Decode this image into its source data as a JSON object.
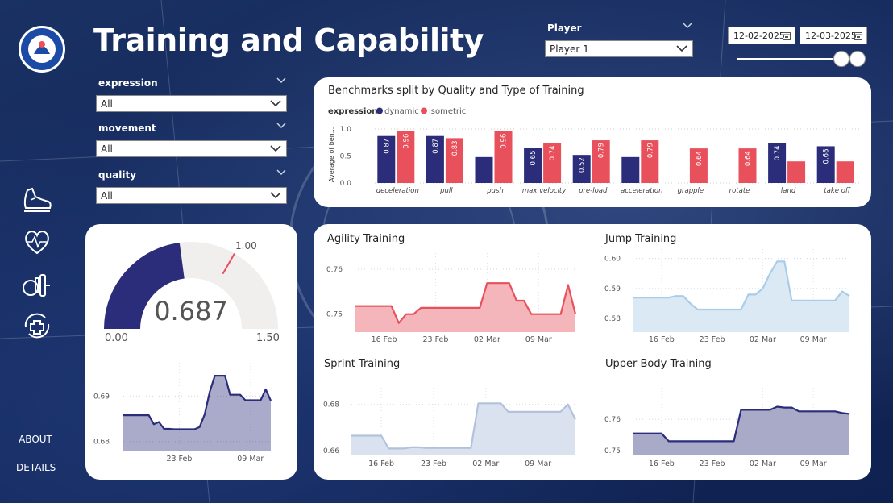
{
  "header": {
    "title": "Training and Capability"
  },
  "filters": {
    "expression": {
      "label": "expression",
      "value": "All"
    },
    "movement": {
      "label": "movement",
      "value": "All"
    },
    "quality": {
      "label": "quality",
      "value": "All"
    }
  },
  "player": {
    "label": "Player",
    "value": "Player 1"
  },
  "date_range": {
    "start": "12-02-2025",
    "end": "12-03-2025",
    "slider_start_pct": 88,
    "slider_end_pct": 100
  },
  "nav": {
    "about": "ABOUT",
    "details": "DETAILS"
  },
  "sidebar_icons": [
    "running-shoe-icon",
    "heart-icon",
    "dumbbell-icon",
    "medical-plus-icon"
  ],
  "colors": {
    "navy": "#2b2d7a",
    "red": "#e8505b",
    "light_blue": "#a9cde9",
    "grey_blue": "#b9c7dd",
    "gauge_bg": "#f0efee",
    "background": "#13275a"
  },
  "chart_data": [
    {
      "type": "bar",
      "title": "Benchmarks split by Quality and Type of Training",
      "legend_title": "expression",
      "legend_position": "top-left",
      "ylabel": "Average of ben...",
      "ylim": [
        0,
        1.0
      ],
      "yticks": [
        "0.0",
        "0.5",
        "1.0"
      ],
      "categories": [
        "deceleration",
        "pull",
        "push",
        "max velocity",
        "pre-load",
        "acceleration",
        "grapple",
        "rotate",
        "land",
        "take off"
      ],
      "series": [
        {
          "name": "dynamic",
          "color": "#2b2d7a",
          "values": [
            0.87,
            0.87,
            0.48,
            0.65,
            0.52,
            0.48,
            null,
            null,
            0.74,
            0.68
          ],
          "labels": [
            "0.87",
            "0.87",
            "",
            "0.65",
            "0.52",
            "",
            "",
            "",
            "0.74",
            "0.68"
          ]
        },
        {
          "name": "isometric",
          "color": "#e8505b",
          "values": [
            0.96,
            0.83,
            0.96,
            0.74,
            0.79,
            0.79,
            0.64,
            0.64,
            0.4,
            0.4
          ],
          "labels": [
            "0.96",
            "0.83",
            "0.96",
            "0.74",
            "0.79",
            "0.79",
            "0.64",
            "0.64",
            "",
            ""
          ]
        }
      ]
    },
    {
      "type": "gauge",
      "value": 0.687,
      "value_label": "0.687",
      "min": 0,
      "max": 1.5,
      "target": 1.0,
      "min_label": "0.00",
      "max_label": "1.50",
      "target_label": "1.00"
    },
    {
      "type": "area",
      "color": "#2b2d7a",
      "ylim": [
        0.678,
        0.697
      ],
      "yticks": [
        0.68,
        0.69
      ],
      "ytick_labels": [
        "0.68",
        "0.69"
      ],
      "xtick_labels": [
        "23 Feb",
        "09 Mar"
      ],
      "xtick_days": [
        11,
        25
      ],
      "x_days": [
        0,
        1,
        2,
        3,
        4,
        5,
        6,
        7,
        8,
        9,
        10,
        11,
        12,
        13,
        14,
        15,
        16,
        17,
        18,
        19,
        20,
        21,
        22,
        23,
        24,
        25,
        26,
        27
      ],
      "values": [
        0.6858,
        0.6858,
        0.6858,
        0.6858,
        0.6858,
        0.6858,
        0.6838,
        0.6843,
        0.6828,
        0.6828,
        0.6827,
        0.6827,
        0.6827,
        0.6827,
        0.6827,
        0.6832,
        0.686,
        0.691,
        0.6945,
        0.6945,
        0.6945,
        0.6903,
        0.6903,
        0.6903,
        0.6891,
        0.6891,
        0.6891,
        0.6891,
        0.6915,
        0.689
      ]
    },
    {
      "type": "area",
      "title": "Agility Training",
      "color": "#e8505b",
      "fill": "#f4b6bb",
      "ylim": [
        0.746,
        0.7625
      ],
      "yticks": [
        0.75,
        0.76
      ],
      "ytick_labels": [
        "0.75",
        "0.76"
      ],
      "xtick_labels": [
        "16 Feb",
        "23 Feb",
        "02 Mar",
        "09 Mar"
      ],
      "xtick_days": [
        4,
        11,
        18,
        25
      ],
      "values": [
        0.7518,
        0.7518,
        0.7518,
        0.7518,
        0.7518,
        0.7518,
        0.748,
        0.75,
        0.75,
        0.7514,
        0.7514,
        0.7514,
        0.7514,
        0.7514,
        0.7514,
        0.7514,
        0.7514,
        0.7514,
        0.7569,
        0.7569,
        0.7569,
        0.7569,
        0.753,
        0.753,
        0.75,
        0.75,
        0.75,
        0.75,
        0.75,
        0.7565,
        0.75
      ]
    },
    {
      "type": "area",
      "title": "Jump Training",
      "color": "#a9cde9",
      "fill": "#dbe9f5",
      "ylim": [
        0.5755,
        0.6015
      ],
      "yticks": [
        0.58,
        0.59,
        0.6
      ],
      "ytick_labels": [
        "0.58",
        "0.59",
        "0.60"
      ],
      "xtick_labels": [
        "16 Feb",
        "23 Feb",
        "02 Mar",
        "09 Mar"
      ],
      "xtick_days": [
        4,
        11,
        18,
        25
      ],
      "values": [
        0.587,
        0.587,
        0.587,
        0.587,
        0.587,
        0.587,
        0.5875,
        0.5875,
        0.585,
        0.583,
        0.583,
        0.583,
        0.583,
        0.583,
        0.583,
        0.583,
        0.588,
        0.588,
        0.59,
        0.595,
        0.599,
        0.599,
        0.586,
        0.586,
        0.586,
        0.586,
        0.586,
        0.586,
        0.586,
        0.589,
        0.5875
      ]
    },
    {
      "type": "area",
      "title": "Sprint Training",
      "color": "#b3c2dc",
      "fill": "#dbe2ef",
      "ylim": [
        0.658,
        0.6865
      ],
      "yticks": [
        0.66,
        0.68
      ],
      "ytick_labels": [
        "0.66",
        "0.68"
      ],
      "xtick_labels": [
        "16 Feb",
        "23 Feb",
        "02 Mar",
        "09 Mar"
      ],
      "xtick_days": [
        4,
        11,
        18,
        25
      ],
      "values": [
        0.6665,
        0.6665,
        0.6665,
        0.6665,
        0.6665,
        0.661,
        0.661,
        0.661,
        0.6615,
        0.6615,
        0.6612,
        0.6612,
        0.6612,
        0.6612,
        0.6612,
        0.6612,
        0.6612,
        0.6805,
        0.6805,
        0.6805,
        0.6805,
        0.6768,
        0.6768,
        0.6768,
        0.6768,
        0.6768,
        0.6768,
        0.6768,
        0.6768,
        0.68,
        0.6735
      ]
    },
    {
      "type": "area",
      "title": "Upper Body Training",
      "color": "#2b2d7a",
      "fill": "#a9a9c8",
      "ylim": [
        0.7485,
        0.7695
      ],
      "yticks": [
        0.75,
        0.76
      ],
      "ytick_labels": [
        "0.75",
        "0.76"
      ],
      "xtick_labels": [
        "16 Feb",
        "23 Feb",
        "02 Mar",
        "09 Mar"
      ],
      "xtick_days": [
        4,
        11,
        18,
        25
      ],
      "values": [
        0.7555,
        0.7555,
        0.7555,
        0.7555,
        0.7555,
        0.753,
        0.753,
        0.753,
        0.753,
        0.753,
        0.753,
        0.753,
        0.753,
        0.753,
        0.753,
        0.763,
        0.763,
        0.763,
        0.763,
        0.763,
        0.764,
        0.7637,
        0.7637,
        0.7625,
        0.7625,
        0.7625,
        0.7625,
        0.7625,
        0.7625,
        0.762,
        0.7617
      ]
    }
  ]
}
